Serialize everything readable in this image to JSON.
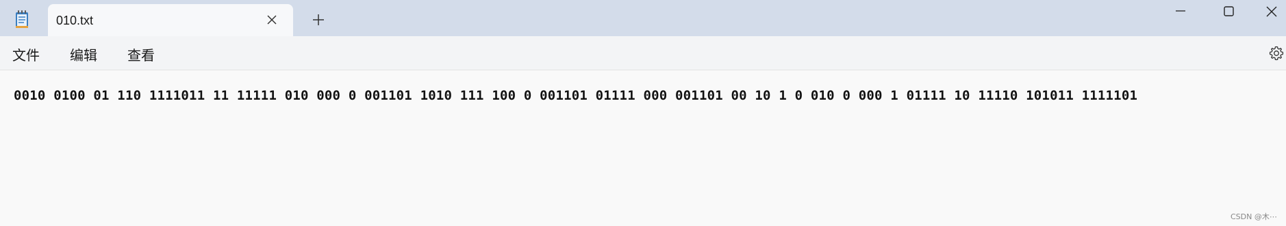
{
  "tab": {
    "title": "010.txt"
  },
  "menu": {
    "file": "文件",
    "edit": "编辑",
    "view": "查看"
  },
  "editor": {
    "content": "0010 0100 01 110 1111011 11 11111 010 000 0 001101 1010 111 100 0 001101 01111 000 001101 00 10 1 0 010 0 000 1 01111 10 11110 101011 1111101"
  },
  "watermark": "CSDN @木⋯",
  "icons": {
    "app": "notepad-icon",
    "close_tab": "close-icon",
    "new_tab": "plus-icon",
    "minimize": "minimize-icon",
    "maximize": "maximize-icon",
    "close_window": "close-window-icon",
    "settings": "gear-icon"
  },
  "colors": {
    "titlebar": "#d3dcea",
    "tab": "#f7f8fa",
    "menubar": "#f3f4f6",
    "editor": "#f9f9f9",
    "app_icon": "#3a7fc1"
  }
}
